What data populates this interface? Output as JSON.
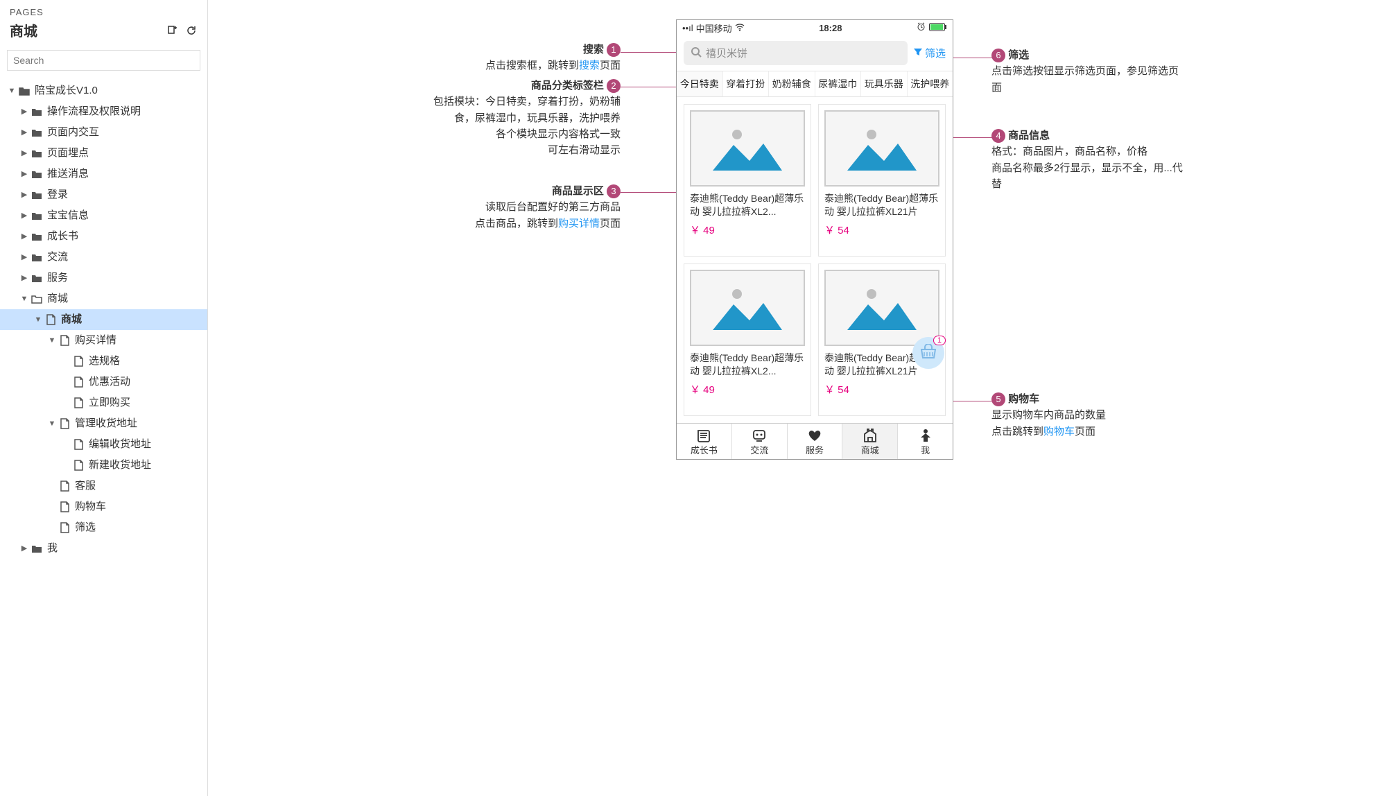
{
  "sidebar": {
    "pages_label": "PAGES",
    "title": "商城",
    "search_placeholder": "Search",
    "tree": {
      "root": "陪宝成长V1.0",
      "items": [
        "操作流程及权限说明",
        "页面内交互",
        "页面埋点",
        "推送消息",
        "登录",
        "宝宝信息",
        "成长书",
        "交流",
        "服务"
      ],
      "mall": "商城",
      "mall_page": "商城",
      "mall_children": [
        "购买详情",
        "选规格",
        "优惠活动",
        "立即购买",
        "管理收货地址",
        "编辑收货地址",
        "新建收货地址",
        "客服",
        "购物车",
        "筛选"
      ],
      "me": "我"
    }
  },
  "phone": {
    "carrier": "中国移动",
    "time": "18:28",
    "search_placeholder": "禧贝米饼",
    "filter_label": "筛选",
    "tabs": [
      "今日特卖",
      "穿着打扮",
      "奶粉辅食",
      "尿裤湿巾",
      "玩具乐器",
      "洗护喂养"
    ],
    "products": [
      {
        "name": "泰迪熊(Teddy Bear)超薄乐动 婴儿拉拉裤XL2...",
        "price": "￥ 49"
      },
      {
        "name": "泰迪熊(Teddy Bear)超薄乐动 婴儿拉拉裤XL21片",
        "price": "￥ 54"
      },
      {
        "name": "泰迪熊(Teddy Bear)超薄乐动 婴儿拉拉裤XL2...",
        "price": "￥ 49"
      },
      {
        "name": "泰迪熊(Teddy Bear)超薄乐动 婴儿拉拉裤XL21片",
        "price": "￥ 54"
      }
    ],
    "cart_badge": "1",
    "tab_bar": [
      "成长书",
      "交流",
      "服务",
      "商城",
      "我"
    ]
  },
  "annos": {
    "a1": {
      "num": "1",
      "title": "搜索",
      "body_pre": "点击搜索框，跳转到",
      "link": "搜索",
      "body_post": "页面"
    },
    "a2": {
      "num": "2",
      "title": "商品分类标签栏",
      "body": "包括模块：今日特卖，穿着打扮，奶粉辅食，尿裤湿巾，玩具乐器，洗护喂养\n各个模块显示内容格式一致\n可左右滑动显示"
    },
    "a3": {
      "num": "3",
      "title": "商品显示区",
      "body_pre": "读取后台配置好的第三方商品\n点击商品，跳转到",
      "link": "购买详情",
      "body_post": "页面"
    },
    "a4": {
      "num": "4",
      "title": "商品信息",
      "body": "格式：商品图片，商品名称，价格\n商品名称最多2行显示，显示不全，用...代替"
    },
    "a5": {
      "num": "5",
      "title": "购物车",
      "body_pre": "显示购物车内商品的数量\n点击跳转到",
      "link": "购物车",
      "body_post": "页面"
    },
    "a6": {
      "num": "6",
      "title": "筛选",
      "body": "点击筛选按钮显示筛选页面，参见筛选页面"
    }
  }
}
